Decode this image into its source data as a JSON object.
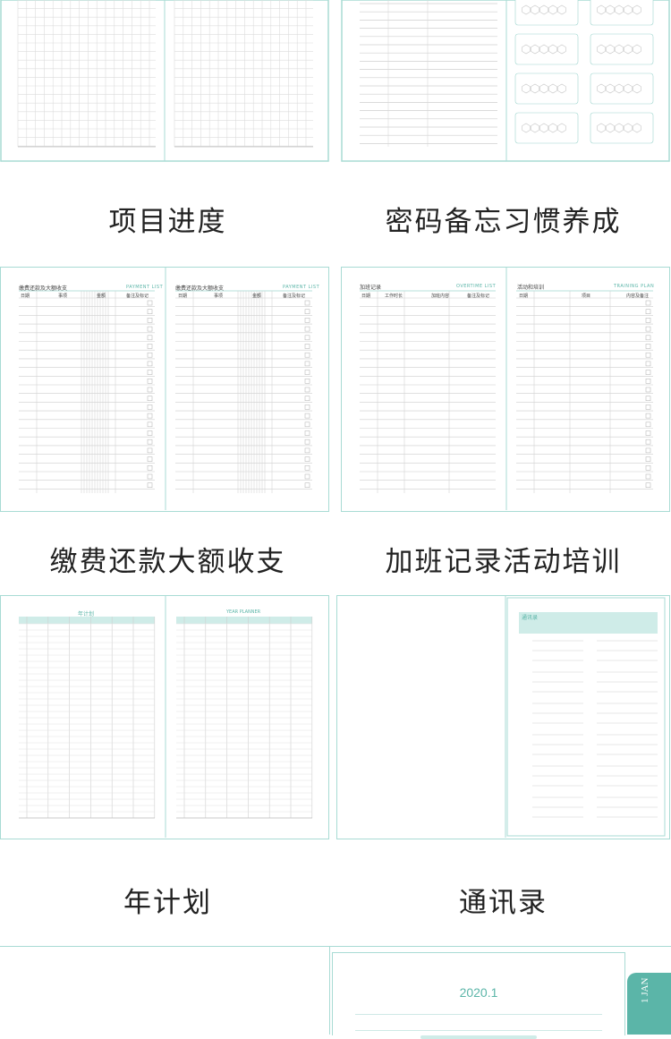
{
  "captions": {
    "progress": "项目进度",
    "password_habit": "密码备忘习惯养成",
    "payment": "缴费还款大额收支",
    "overtime_training": "加班记录活动培训",
    "year_plan": "年计划",
    "contacts": "通讯录"
  },
  "payment_sheet": {
    "title_left": "缴费还款及大额收支",
    "title_right": "缴费还款及大额收支",
    "en": "PAYMENT LIST",
    "col_date": "日期",
    "col_item": "事项",
    "col_amount": "金额",
    "col_note": "备注及标记"
  },
  "overtime_sheet": {
    "title": "加班记录",
    "en": "OVERTIME LIST",
    "col_date": "日期",
    "col_hours": "工作时长",
    "col_content": "加班内容",
    "col_note": "备注及标记"
  },
  "training_sheet": {
    "title": "活动和培训",
    "en": "TRAINING PLAN",
    "col_date": "日期",
    "col_topic": "项目",
    "col_note": "内容及备注"
  },
  "year_planner": {
    "title_left": "年计划",
    "title_right": "YEAR PLANNER"
  },
  "contacts_sheet": {
    "title": "通讯录"
  },
  "calendar_peek": {
    "month": "2020.1",
    "tab": "1 JAN"
  },
  "colors": {
    "accent": "#5bb5a8",
    "border": "#9fd6cf",
    "grid": "#d6d6d6"
  }
}
